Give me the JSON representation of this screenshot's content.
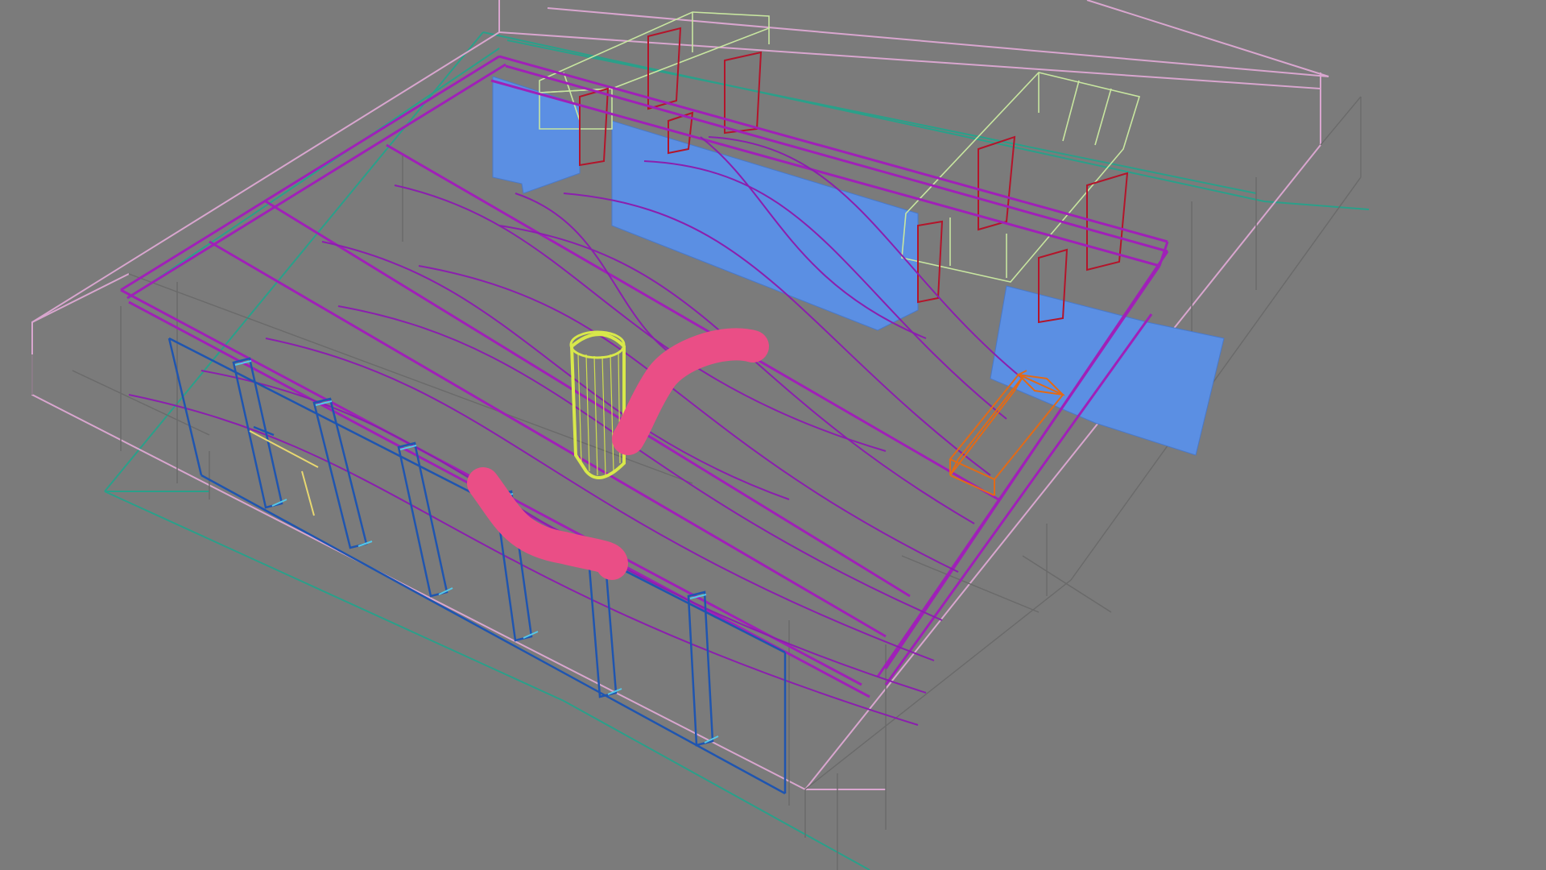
{
  "viewport": {
    "background": "#7b7b7b",
    "view_mode": "wireframe-perspective"
  },
  "colors": {
    "room_outline_light": "#d9a6cf",
    "floor_outline": "#2aa08a",
    "structural_lines": "#6f6f6f",
    "ceiling_beams": "#a020b8",
    "ceiling_waves": "#8b1fae",
    "blue_panels": "#5b8fe3",
    "front_glass_frames": "#1f55b0",
    "glass_mullions": "#55c8e8",
    "mezzanine_boxes": "#c8e6a0",
    "door_frames": "#b4142a",
    "yellow_cylinder": "#d8e84a",
    "pink_tube": "#ea4e86",
    "orange_object": "#e36a16"
  },
  "objects": [
    {
      "name": "room-shell",
      "type": "wireframe-box"
    },
    {
      "name": "floor-plane",
      "type": "plane"
    },
    {
      "name": "ceiling-beam-grid",
      "type": "beam-set"
    },
    {
      "name": "wave-ceiling-ribbons",
      "type": "curve-set"
    },
    {
      "name": "blue-wall-panels",
      "type": "solid-surface"
    },
    {
      "name": "front-glass-facade",
      "type": "frame-set"
    },
    {
      "name": "upper-mezzanine",
      "type": "wireframe-box"
    },
    {
      "name": "door-frames",
      "type": "frame-set"
    },
    {
      "name": "yellow-cylinder",
      "type": "cylinder"
    },
    {
      "name": "pink-sculpture",
      "type": "tube"
    },
    {
      "name": "orange-bench",
      "type": "wireframe-box"
    }
  ]
}
